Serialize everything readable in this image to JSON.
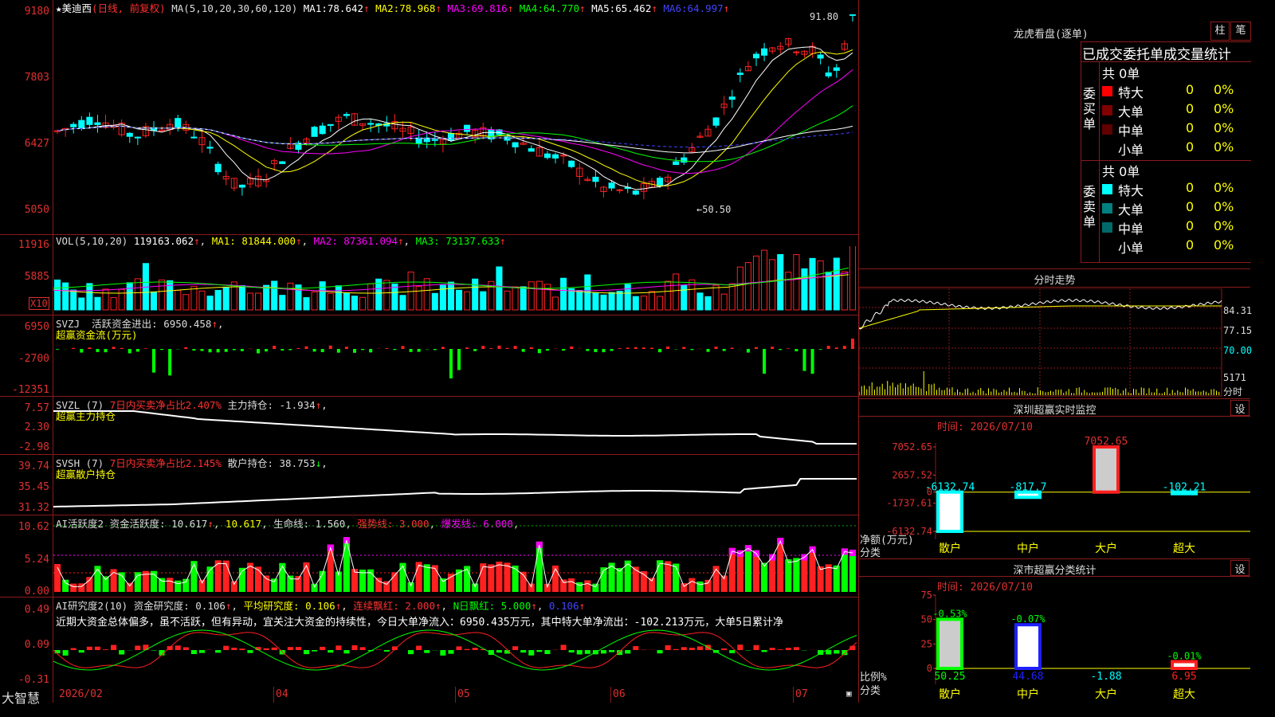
{
  "app_name": "大智慧",
  "stock": {
    "name": "美迪西",
    "mode": "(日线, 前复权)",
    "ma_spec": "MA(5,10,20,30,60,120)",
    "ma": [
      {
        "label": "MA1:",
        "value": "78.642",
        "color": "#ffffff"
      },
      {
        "label": "MA2:",
        "value": "78.968",
        "color": "#ffff00"
      },
      {
        "label": "MA3:",
        "value": "69.816",
        "color": "#ff00ff"
      },
      {
        "label": "MA4:",
        "value": "64.770",
        "color": "#00ff00"
      },
      {
        "label": "MA5:",
        "value": "65.462",
        "color": "#ffffff"
      },
      {
        "label": "MA6:",
        "value": "64.997",
        "color": "#4040ff"
      }
    ],
    "y_labels": [
      "9180",
      "7803",
      "6427",
      "5050"
    ],
    "high_marker": "91.80",
    "low_marker": "←50.50"
  },
  "vol": {
    "title": "VOL(5,10,20)",
    "value": "119163.062",
    "ma1": "MA1: 81844.000",
    "ma2": "MA2: 87361.094",
    "ma3": "MA3: 73137.633",
    "y_labels": [
      "11916",
      "5885"
    ],
    "unit": "X10"
  },
  "svzj": {
    "title": "SVZJ",
    "label": "活跃资金进出:",
    "value": "6950.458",
    "subtitle": "超赢资金流(万元)",
    "y_labels": [
      "6950",
      "-2700",
      "-12351"
    ]
  },
  "svzl": {
    "title": "SVZL (7)",
    "desc": "7日内买卖净占比2.407%",
    "label": "主力持仓:",
    "value": "-1.934",
    "subtitle": "超赢主力持仓",
    "y_labels": [
      "7.57",
      "2.30",
      "-2.98"
    ]
  },
  "svsh": {
    "title": "SVSH (7)",
    "desc": "7日内买卖净占比2.145%",
    "label": "散户持仓:",
    "value": "38.753",
    "subtitle": "超赢散户持仓",
    "y_labels": [
      "39.74",
      "35.45",
      "31.32"
    ]
  },
  "ai_active": {
    "title": "AI活跃度2",
    "label": "资金活跃度:",
    "value": "10.617",
    "value2": "10.617",
    "life": "生命线: 1.560",
    "strong": "强势线: 3.000",
    "burst": "爆发线: 6.000",
    "y_labels": [
      "10.62",
      "5.24",
      "0.00"
    ]
  },
  "ai_research": {
    "title": "AI研究度2(10)",
    "label": "资金研究度:",
    "value": "0.106",
    "avg": "平均研究度: 0.106",
    "red": "连续飘红: 2.000",
    "nred": "N日飘红: 5.000",
    "last": "0.106",
    "text": "近期大资金总体偏多，虽不活跃，但有异动，宜关注大资金的持续性，今日大单净流入：6950.435万元，其中特大单净流出：-102.213万元，大单5日累计净",
    "y_labels": [
      "0.49",
      "0.09",
      "-0.31"
    ]
  },
  "x_axis": [
    "2026/02",
    "04",
    "05",
    "06",
    "07"
  ],
  "lhb": {
    "title": "龙虎看盘(逐单)",
    "btn1": "柱",
    "btn2": "笔",
    "subtitle": "已成交委托单成交量统计",
    "buy": {
      "label": "委买单",
      "total": "共 0单",
      "rows": [
        {
          "name": "特大",
          "n": "0",
          "p": "0%",
          "color": "#ff0000"
        },
        {
          "name": "大单",
          "n": "0",
          "p": "0%",
          "color": "#800000"
        },
        {
          "name": "中单",
          "n": "0",
          "p": "0%",
          "color": "#600000"
        },
        {
          "name": "小单",
          "n": "0",
          "p": "0%",
          "color": "#000000"
        }
      ]
    },
    "sell": {
      "label": "委卖单",
      "total": "共 0单",
      "rows": [
        {
          "name": "特大",
          "n": "0",
          "p": "0%",
          "color": "#00ffff"
        },
        {
          "name": "大单",
          "n": "0",
          "p": "0%",
          "color": "#008080"
        },
        {
          "name": "中单",
          "n": "0",
          "p": "0%",
          "color": "#006a6a"
        },
        {
          "name": "小单",
          "n": "0",
          "p": "0%",
          "color": "#000000"
        }
      ]
    }
  },
  "fenshi": {
    "title": "分时走势",
    "y_labels": [
      "84.31",
      "77.15",
      "70.00"
    ],
    "vol_label": "5171",
    "vol_unit": "分时"
  },
  "monitor": {
    "title": "深圳超赢实时监控",
    "btn": "设",
    "time": "时间: 2026/07/10",
    "y_labels": [
      "7052.65",
      "2657.52",
      "0",
      "-1737.61",
      "-6132.74"
    ],
    "ylabel1": "净额(万元)",
    "ylabel2": "分类",
    "chart_data": {
      "type": "bar",
      "categories": [
        "散户",
        "中户",
        "大户",
        "超大"
      ],
      "values": [
        -6132.74,
        -817.7,
        7052.65,
        -102.21
      ],
      "value_labels": [
        "-6132.74",
        "-817.7",
        "7052.65",
        "-102.21"
      ],
      "ylim": [
        -6132.74,
        7052.65
      ]
    }
  },
  "classify": {
    "title": "深市超赢分类统计",
    "btn": "设",
    "time": "时间: 2026/07/10",
    "y_labels": [
      "75",
      "50",
      "25",
      "0"
    ],
    "ylabel1": "比例%",
    "ylabel2": "分类",
    "chart_data": {
      "type": "bar",
      "categories": [
        "散户",
        "中户",
        "大户",
        "超大"
      ],
      "values": [
        50.25,
        44.68,
        -1.88,
        6.95
      ],
      "bottom_labels": [
        "50.25",
        "44.68",
        "-1.88",
        "6.95"
      ],
      "top_labels": [
        "-0.53%",
        "-0.07%",
        "",
        "-0.01%"
      ],
      "ylim": [
        0,
        75
      ]
    }
  }
}
